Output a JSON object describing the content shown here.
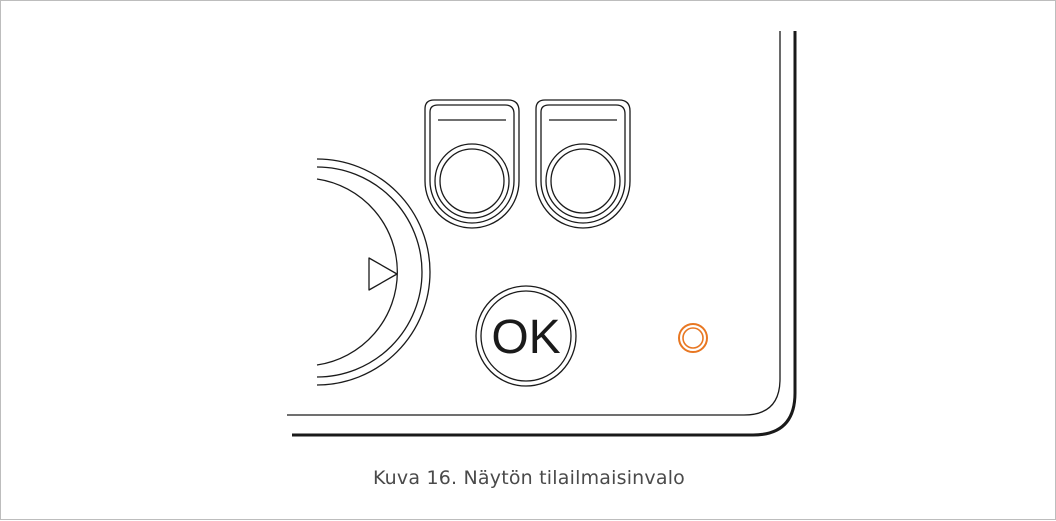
{
  "figure": {
    "caption": "Kuva 16. Näytön tilailmaisinvalo",
    "ok_label": "OK",
    "indicator_color": "#e87722",
    "line_color": "#1a1a1a",
    "icons": [
      "dial-play-arrow-icon",
      "indicator-led-icon"
    ]
  }
}
